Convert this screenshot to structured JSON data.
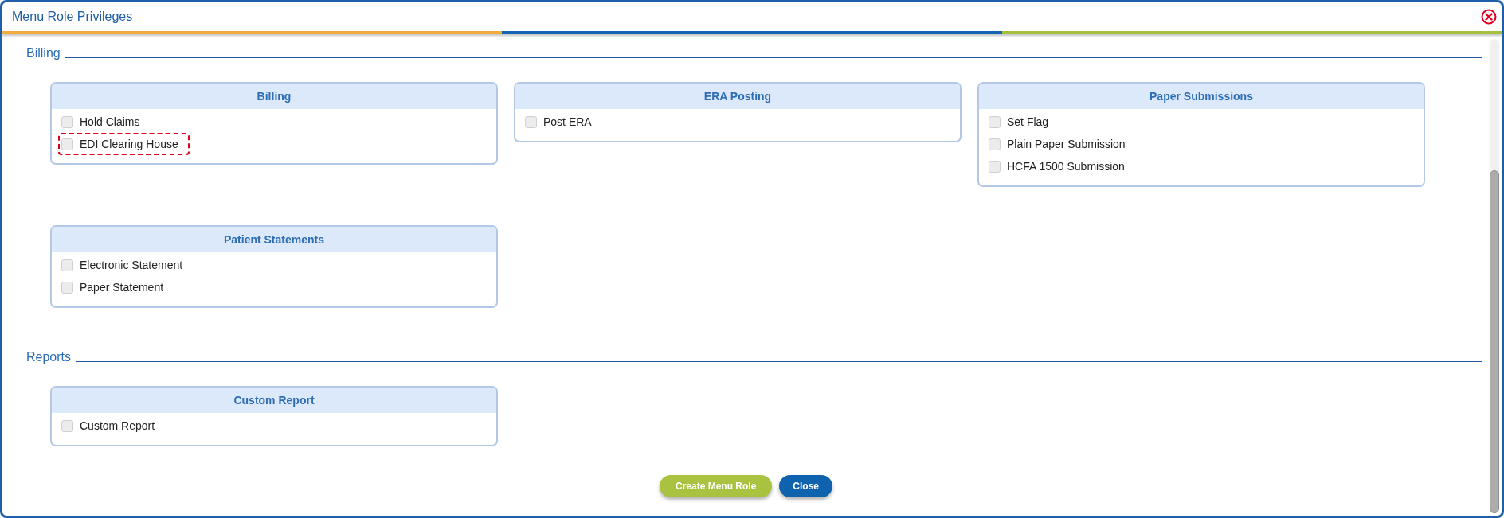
{
  "window": {
    "title": "Menu Role Privileges"
  },
  "sections": [
    {
      "title": "Billing",
      "groups": [
        {
          "title": "Billing",
          "items": [
            {
              "label": "Hold Claims",
              "checked": false,
              "highlighted": false
            },
            {
              "label": "EDI Clearing House",
              "checked": false,
              "highlighted": true
            }
          ]
        },
        {
          "title": "ERA Posting",
          "items": [
            {
              "label": "Post ERA",
              "checked": false,
              "highlighted": false
            }
          ]
        },
        {
          "title": "Paper Submissions",
          "items": [
            {
              "label": "Set Flag",
              "checked": false,
              "highlighted": false
            },
            {
              "label": "Plain Paper Submission",
              "checked": false,
              "highlighted": false
            },
            {
              "label": "HCFA 1500 Submission",
              "checked": false,
              "highlighted": false
            }
          ]
        },
        {
          "title": "Patient Statements",
          "items": [
            {
              "label": "Electronic Statement",
              "checked": false,
              "highlighted": false
            },
            {
              "label": "Paper Statement",
              "checked": false,
              "highlighted": false
            }
          ]
        }
      ]
    },
    {
      "title": "Reports",
      "groups": [
        {
          "title": "Custom Report",
          "items": [
            {
              "label": "Custom Report",
              "checked": false,
              "highlighted": false
            }
          ]
        }
      ]
    }
  ],
  "buttons": [
    {
      "label": "Create Menu Role",
      "kind": "primary"
    },
    {
      "label": "Close",
      "kind": "secondary"
    }
  ]
}
